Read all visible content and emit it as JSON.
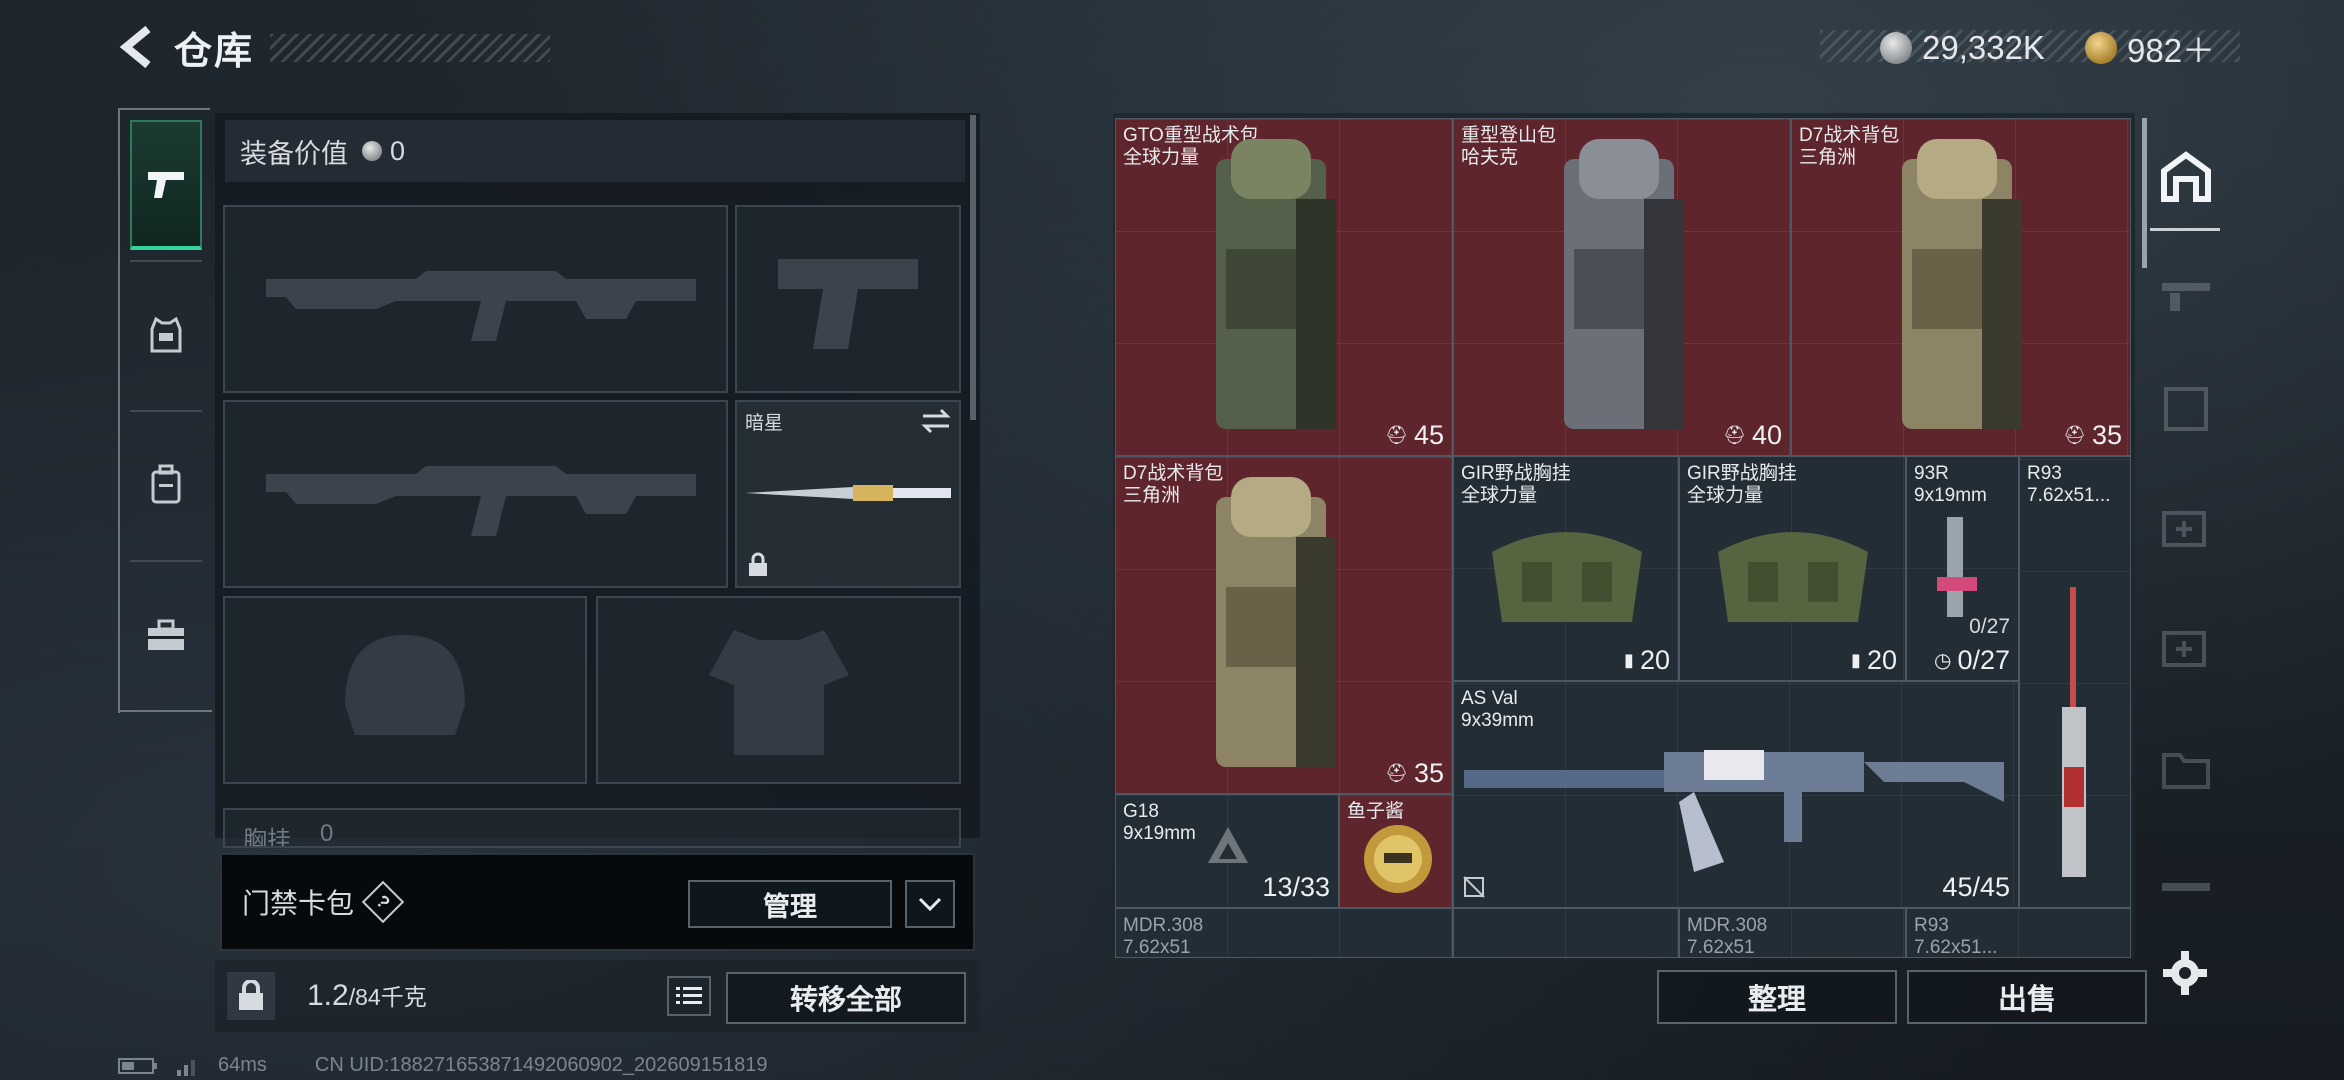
{
  "header": {
    "title": "仓库"
  },
  "currency": {
    "silver": "29,332K",
    "gold": "982＋"
  },
  "equipment": {
    "value_label": "装备价值",
    "value": "0"
  },
  "melee": {
    "name": "暗星"
  },
  "chest_partial_label": "胸挂",
  "chest_partial_value": "0",
  "card_bag": {
    "label": "门禁卡包",
    "help": "?",
    "manage": "管理"
  },
  "weight": {
    "current": "1.2",
    "max": "/84千克",
    "transfer_all": "转移全部"
  },
  "stash_buttons": {
    "sort": "整理",
    "sell": "出售"
  },
  "status": {
    "ping": "64ms",
    "uid": "CN UID:188271653871492060902_202609151819"
  },
  "items": [
    {
      "name": "GTO重型战术包",
      "sub": "全球力量",
      "count": "45"
    },
    {
      "name": "重型登山包",
      "sub": "哈夫克",
      "count": "40"
    },
    {
      "name": "D7战术背包",
      "sub": "三角洲",
      "count": "35"
    },
    {
      "name": "D7战术背包",
      "sub": "三角洲",
      "count": "35"
    },
    {
      "name": "GIR野战胸挂",
      "sub": "全球力量",
      "count": "20"
    },
    {
      "name": "GIR野战胸挂",
      "sub": "全球力量",
      "count": "20"
    },
    {
      "name": "93R",
      "sub": "9x19mm",
      "ammo": "0/27",
      "count": "0/27"
    },
    {
      "name": "R93",
      "sub": "7.62x51..."
    },
    {
      "name": "AS Val",
      "sub": "9x39mm",
      "count": "45/45"
    },
    {
      "name": "G18",
      "sub": "9x19mm",
      "count": "13/33"
    },
    {
      "name": "鱼子酱"
    },
    {
      "name": "MDR.308",
      "sub": "7.62x51"
    },
    {
      "name": "MDR.308",
      "sub": "7.62x51"
    },
    {
      "name": "R93",
      "sub": "7.62x51..."
    }
  ],
  "colors": {
    "accent_green": "#35d49a",
    "rare_red": "#5e252c",
    "panel": "#232d36"
  }
}
